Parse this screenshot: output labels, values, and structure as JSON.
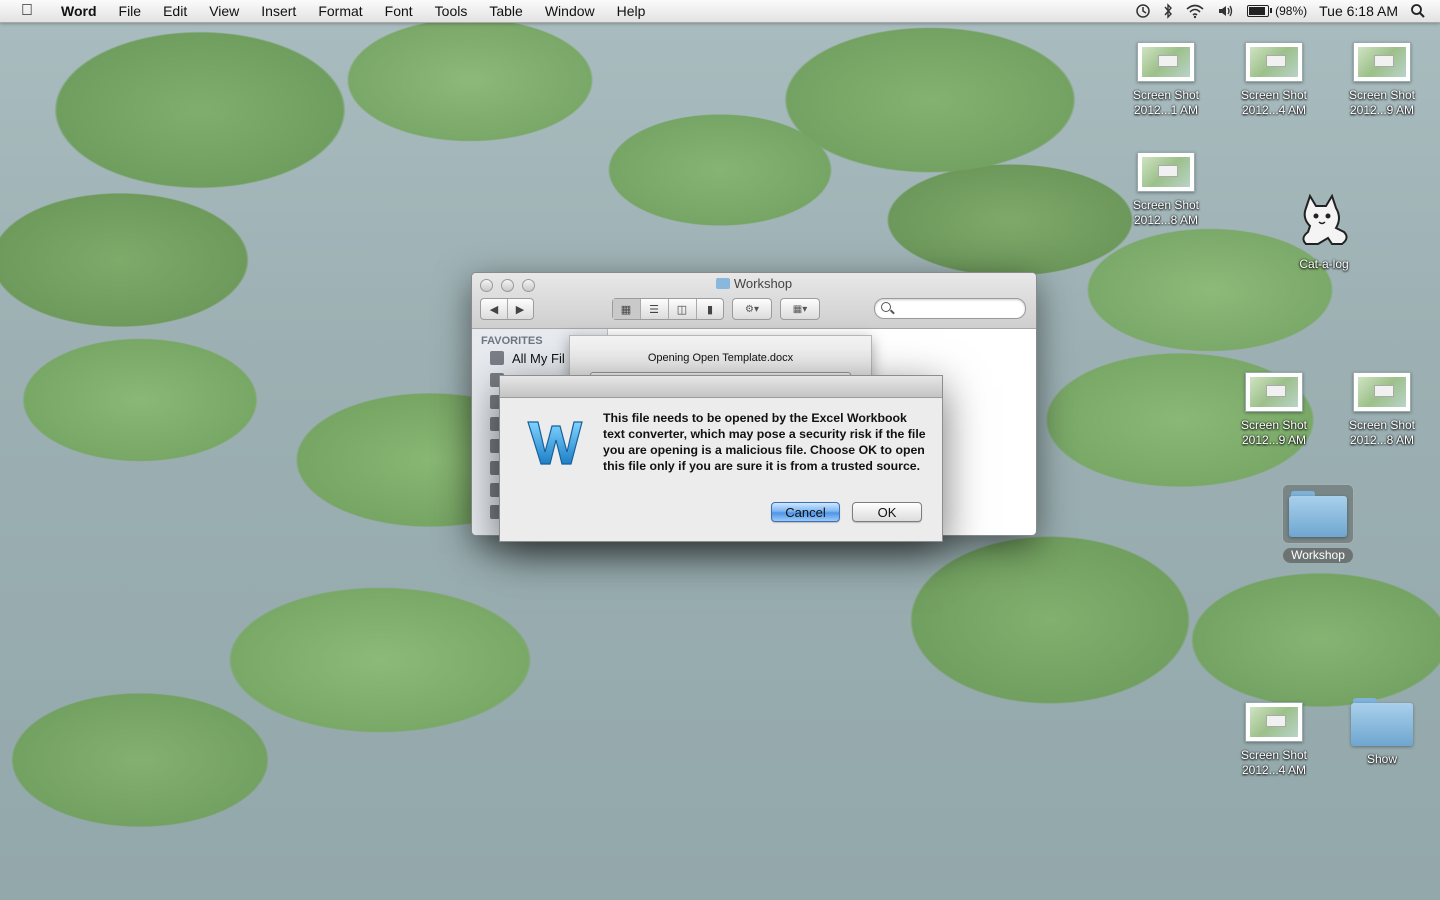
{
  "menubar": {
    "apple_icon": "apple-icon",
    "app_name": "Word",
    "menus": [
      "File",
      "Edit",
      "View",
      "Insert",
      "Format",
      "Font",
      "Tools",
      "Table",
      "Window",
      "Help"
    ],
    "battery_percent": "(98%)",
    "battery_level": 0.98,
    "clock": "Tue 6:18 AM"
  },
  "desktop": {
    "icons": [
      {
        "line1": "Screen Shot",
        "line2": "2012...1 AM"
      },
      {
        "line1": "Screen Shot",
        "line2": "2012...4 AM"
      },
      {
        "line1": "Screen Shot",
        "line2": "2012...9 AM"
      },
      {
        "line1": "Screen Shot",
        "line2": "2012...8 AM"
      },
      {
        "line1": "Cat-a-log",
        "line2": ""
      },
      {
        "line1": "Screen Shot",
        "line2": "2012...9 AM"
      },
      {
        "line1": "Screen Shot",
        "line2": "2012...8 AM"
      },
      {
        "line1": "Workshop",
        "line2": ""
      },
      {
        "line1": "Screen Shot",
        "line2": "2012...4 AM"
      },
      {
        "line1": "Show",
        "line2": ""
      }
    ]
  },
  "finder": {
    "title": "Workshop",
    "sidebar_heading": "FAVORITES",
    "sidebar_first_item": "All My Fil"
  },
  "opening_sheet": {
    "text": "Opening Open Template.docx"
  },
  "alert": {
    "message": "This file needs to be opened by the Excel Workbook text converter, which may pose a security risk if the file you are opening is a malicious file.  Choose OK to open this file only if you are sure it is from a trusted source.",
    "cancel_label": "Cancel",
    "ok_label": "OK",
    "icon": "word-app-icon"
  }
}
